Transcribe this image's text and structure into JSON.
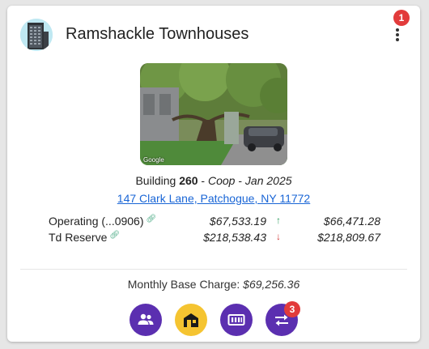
{
  "property": {
    "title": "Ramshackle Townhouses",
    "avatar_icon": "building-icon",
    "menu_icon": "more-vertical-icon",
    "notification_count": "1",
    "photo_watermark": "Google"
  },
  "building": {
    "prefix": "Building",
    "number": "260",
    "sep1": " - ",
    "type": "Coop",
    "sep2": " - ",
    "date": "Jan 2025",
    "address": "147 Clark Lane, Patchogue, NY 11772"
  },
  "funds": [
    {
      "name": "Operating (...0906)",
      "link_icon": "link-icon",
      "current": "$67,533.19",
      "trend": "up",
      "trend_color": "#2e9b5e",
      "previous": "$66,471.28"
    },
    {
      "name": "Td Reserve",
      "link_icon": "link-icon",
      "current": "$218,538.43",
      "trend": "down",
      "trend_color": "#d23a3a",
      "previous": "$218,809.67"
    }
  ],
  "charge": {
    "label": "Monthly Base Charge:",
    "value": "$69,256.36"
  },
  "actions": [
    {
      "icon": "people-icon",
      "color": "#5b2fb0"
    },
    {
      "icon": "house-icon",
      "color": "#f5c431"
    },
    {
      "icon": "meter-icon",
      "color": "#5b2fb0"
    },
    {
      "icon": "transfer-icon",
      "color": "#5b2fb0",
      "badge": "3"
    }
  ],
  "colors": {
    "badge": "#e23b3b",
    "link": "#1a66d6",
    "link_icon": "#3aa37a"
  }
}
